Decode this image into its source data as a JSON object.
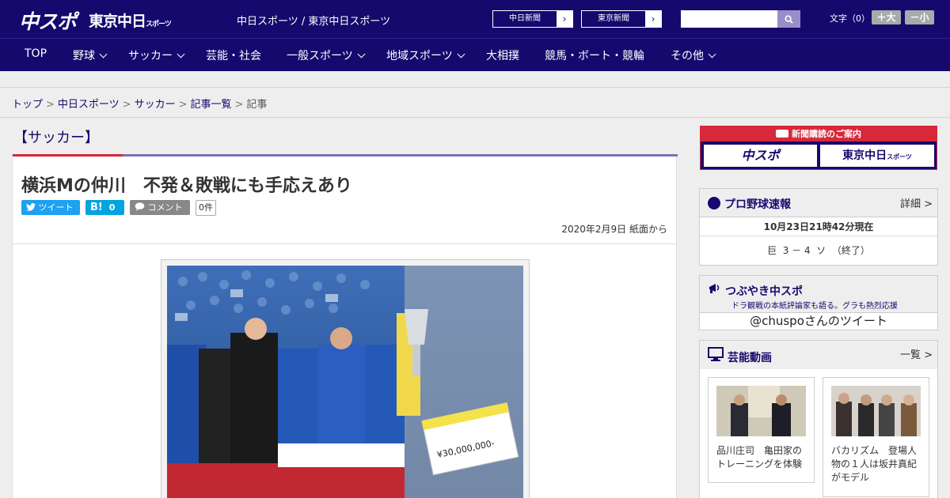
{
  "header": {
    "logo_main": "中スポ",
    "logo_sub": "東京中日",
    "logo_sub_small": "スポーツ",
    "tagline": "中日スポーツ / 東京中日スポーツ",
    "paper_links": [
      "中日新聞",
      "東京新聞"
    ],
    "font_size_label": "文字（0）",
    "font_plus": "＋大",
    "font_minus": "－小"
  },
  "nav": {
    "items": [
      {
        "label": "TOP",
        "dropdown": false
      },
      {
        "label": "野球",
        "dropdown": true
      },
      {
        "label": "サッカー",
        "dropdown": true
      },
      {
        "label": "芸能・社会",
        "dropdown": false
      },
      {
        "label": "一般スポーツ",
        "dropdown": true
      },
      {
        "label": "地域スポーツ",
        "dropdown": true
      },
      {
        "label": "大相撲",
        "dropdown": false
      },
      {
        "label": "競馬・ボート・競輪",
        "dropdown": false
      },
      {
        "label": "その他",
        "dropdown": true
      }
    ]
  },
  "breadcrumb": {
    "links": [
      "トップ",
      "中日スポーツ",
      "サッカー",
      "記事一覧"
    ],
    "current": "記事"
  },
  "article": {
    "category": "【サッカー】",
    "headline": "横浜Mの仲川　不発＆敗戦にも手応えあり",
    "tweet_label": "ツイート",
    "hatena_label": "B!",
    "hatena_count": "0",
    "comment_label": "コメント",
    "comment_count": "0件",
    "date": "2020年2月9日 紙面から",
    "photo_check_text": "¥30,000,000-"
  },
  "sidebar": {
    "subscribe": {
      "title": "新聞購読のご案内",
      "paper1": "中スポ",
      "paper2": "東京中日",
      "paper2_small": "スポーツ"
    },
    "baseball": {
      "title": "プロ野球速報",
      "more": "詳細 >",
      "updated": "10月23日21時42分現在",
      "score": "巨  3 － 4  ソ  （終了）"
    },
    "tweets": {
      "title": "つぶやき中スポ",
      "subtitle": "ドラ観戦の本紙評論家も語る。グラも熱烈応援",
      "link": "@chuspoさんのツイート"
    },
    "video": {
      "title": "芸能動画",
      "more": "一覧 >",
      "items": [
        {
          "caption": "品川庄司　亀田家のトレーニングを体験"
        },
        {
          "caption": "バカリズム　登場人物の１人は坂井真紀がモデル"
        }
      ]
    }
  },
  "colors": {
    "brand_navy": "#16096e",
    "accent_red": "#d8283a",
    "accent_purple": "#7a6fb5",
    "twitter_blue": "#1da1f2",
    "hatena_blue": "#00a4de",
    "comment_gray": "#888888"
  }
}
